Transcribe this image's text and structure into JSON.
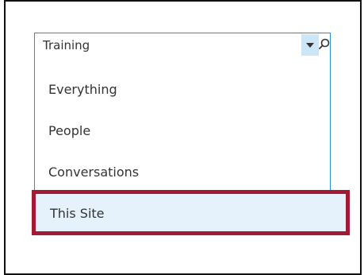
{
  "search": {
    "value": "Training",
    "icons": {
      "dropdown": "chevron-down-icon",
      "search": "search-icon"
    }
  },
  "scopes": [
    {
      "label": "Everything"
    },
    {
      "label": "People"
    },
    {
      "label": "Conversations"
    },
    {
      "label": "This Site"
    }
  ],
  "colors": {
    "focus_border": "#2a8dd4",
    "selection_bg": "#e5f1fb",
    "callout_border": "#a21a33"
  }
}
